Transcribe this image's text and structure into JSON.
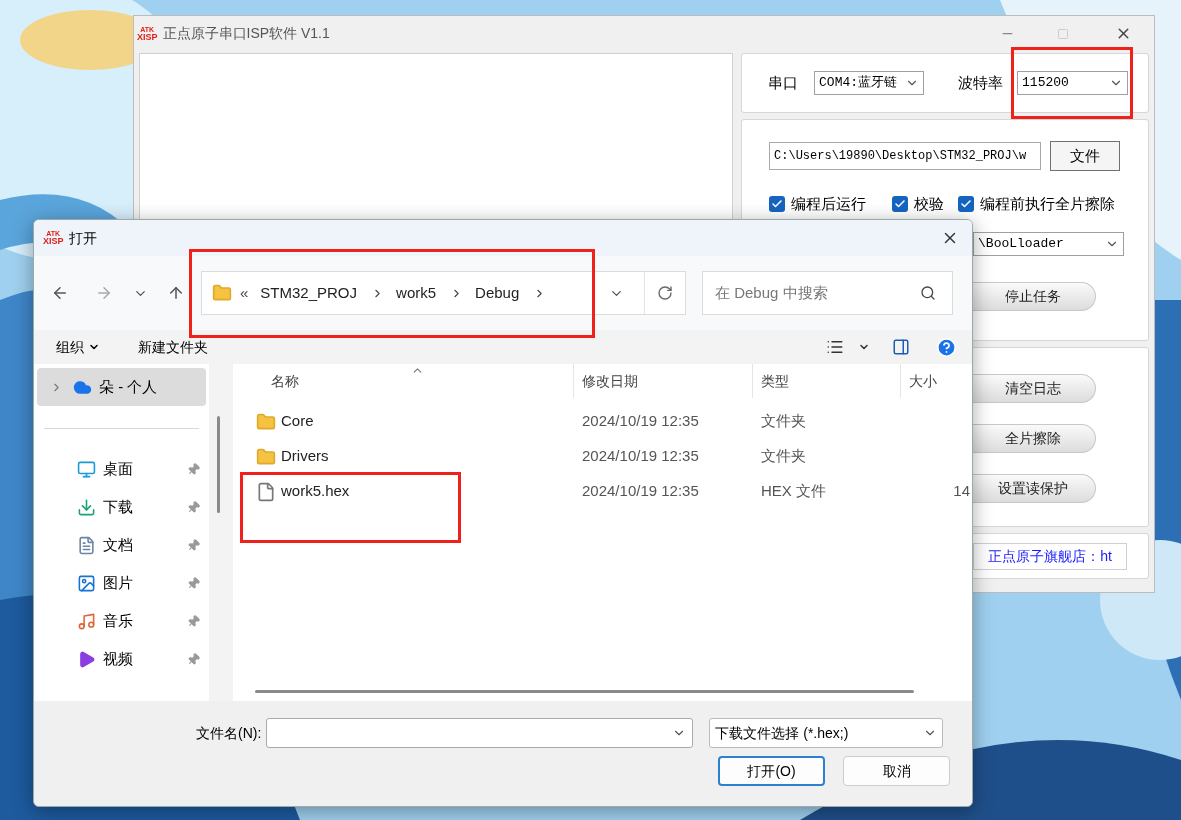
{
  "app_window": {
    "title": "正点原子串口ISP软件 V1.1",
    "logo": [
      "ATK",
      "XISP"
    ],
    "port": {
      "label": "串口",
      "value": "COM4:蓝牙链"
    },
    "baud_rate": {
      "label": "波特率",
      "value": "115200",
      "highlighted": true
    },
    "file_path": {
      "value": "C:\\Users\\19890\\Desktop\\STM32_PROJ\\w",
      "button": "文件"
    },
    "options": [
      {
        "label": "编程后运行",
        "checked": true
      },
      {
        "label": "校验",
        "checked": true
      },
      {
        "label": "编程前执行全片擦除",
        "checked": true
      }
    ],
    "boot_mode": {
      "value": "\\BooLloader"
    },
    "stop_button": "停止任务",
    "actions": [
      "清空日志",
      "全片擦除",
      "设置读保护"
    ],
    "store_link": "正点原子旗舰店：ht"
  },
  "open_dialog": {
    "title": "打开",
    "logo": [
      "ATK",
      "XISP"
    ],
    "address_bar": {
      "overflow": "«",
      "segments": [
        "STM32_PROJ",
        "work5",
        "Debug"
      ],
      "highlighted": true
    },
    "search": {
      "placeholder": "在 Debug 中搜索"
    },
    "toolbar": {
      "organize": "组织",
      "new_folder": "新建文件夹"
    },
    "sidebar": {
      "items": [
        {
          "label": "朵 - 个人",
          "kind": "cloud",
          "selected": true
        },
        {
          "label": "桌面",
          "kind": "desktop",
          "selected": false
        },
        {
          "label": "下载",
          "kind": "download",
          "selected": false
        },
        {
          "label": "文档",
          "kind": "document",
          "selected": false
        },
        {
          "label": "图片",
          "kind": "pictures",
          "selected": false
        },
        {
          "label": "音乐",
          "kind": "music",
          "selected": false
        },
        {
          "label": "视频",
          "kind": "video",
          "selected": false
        }
      ]
    },
    "columns": [
      "名称",
      "修改日期",
      "类型",
      "大小"
    ],
    "files": [
      {
        "name": "Core",
        "kind": "folder",
        "modified": "2024/10/19 12:35",
        "type": "文件夹",
        "highlighted": false
      },
      {
        "name": "Drivers",
        "kind": "folder",
        "modified": "2024/10/19 12:35",
        "type": "文件夹",
        "highlighted": false
      },
      {
        "name": "work5.hex",
        "kind": "file",
        "modified": "2024/10/19 12:35",
        "type": "HEX 文件",
        "size": "14",
        "highlighted": true
      }
    ],
    "file_name": {
      "label": "文件名(N):"
    },
    "file_type": "下载文件选择 (*.hex;)",
    "buttons": [
      {
        "label": "打开(O)",
        "default": true
      },
      {
        "label": "取消",
        "default": false
      }
    ]
  }
}
